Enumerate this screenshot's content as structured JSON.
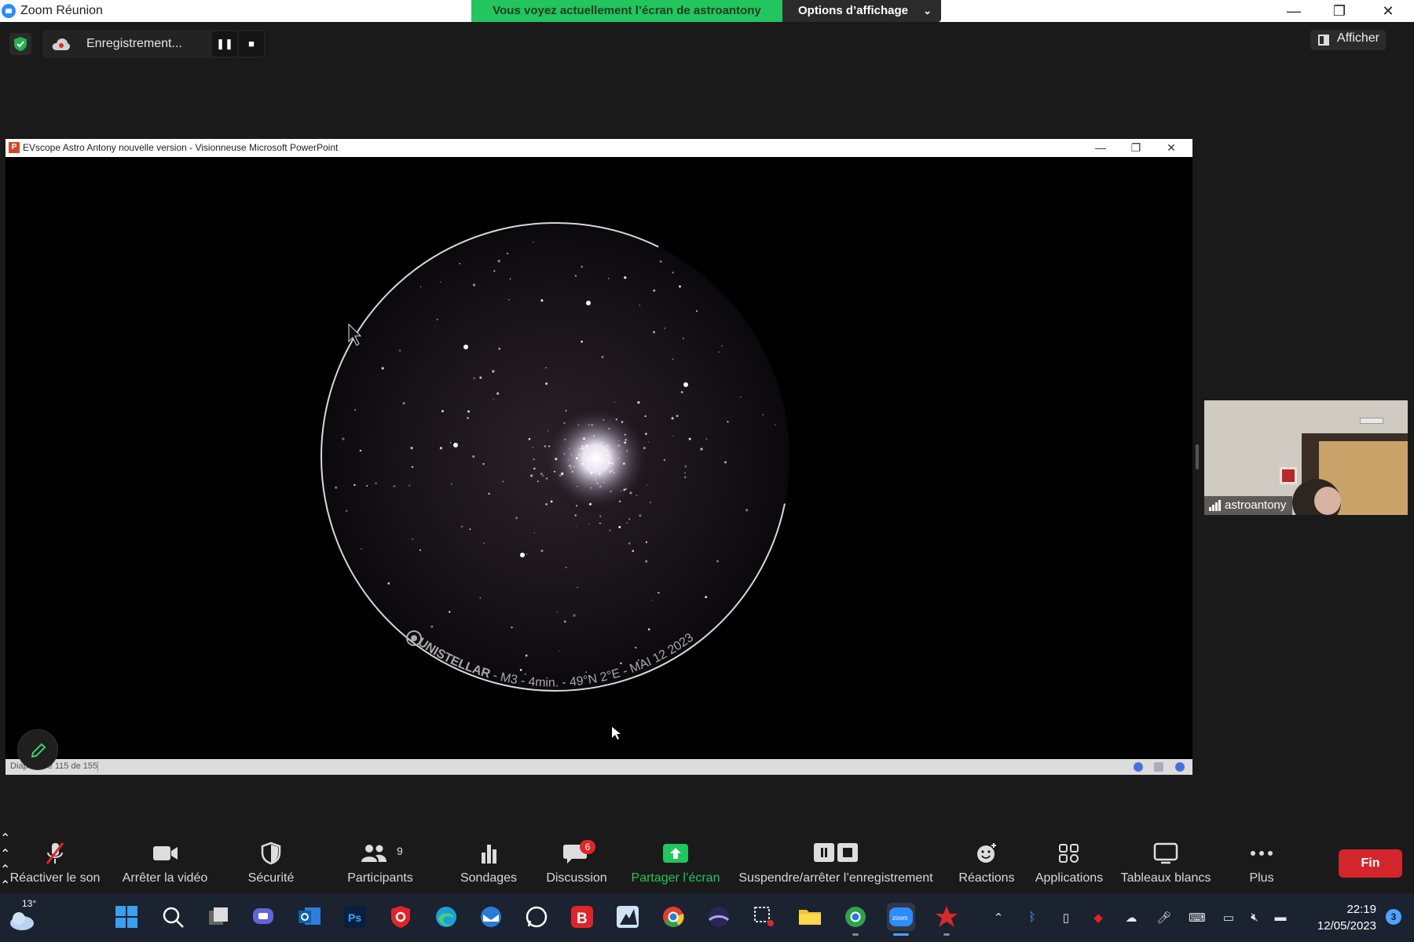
{
  "window": {
    "title": "Zoom Réunion"
  },
  "share_banner": {
    "text": "Vous voyez actuellement l’écran de astroantony",
    "view_options": "Options d’affichage"
  },
  "recording": {
    "label": "Enregistrement..."
  },
  "afficher": {
    "label": "Afficher"
  },
  "ppt": {
    "title": "EVscope Astro Antony nouvelle version - Visionneuse Microsoft PowerPoint",
    "status": "Diapositive 115 de 155",
    "slide_caption_brand": "UNISTELLAR",
    "slide_caption_details": " - M3 - 4min. - 49°N 2°E - MAI 12 2023"
  },
  "participant": {
    "name": "astroantony"
  },
  "controls": {
    "unmute": "Réactiver le son",
    "stop_video": "Arrêter la vidéo",
    "security": "Sécurité",
    "participants": "Participants",
    "participants_count": "9",
    "polls": "Sondages",
    "chat": "Discussion",
    "chat_badge": "6",
    "share": "Partager l’écran",
    "recording_toggle": "Suspendre/arrêter l’enregistrement",
    "reactions": "Réactions",
    "apps": "Applications",
    "whiteboards": "Tableaux blancs",
    "more": "Plus",
    "end": "Fin"
  },
  "taskbar": {
    "temperature": "13°",
    "time": "22:19",
    "date": "12/05/2023",
    "notifications": "3"
  },
  "colors": {
    "share_green": "#23c55e",
    "end_red": "#d3262c",
    "zoom_blue": "#2d8cff"
  }
}
